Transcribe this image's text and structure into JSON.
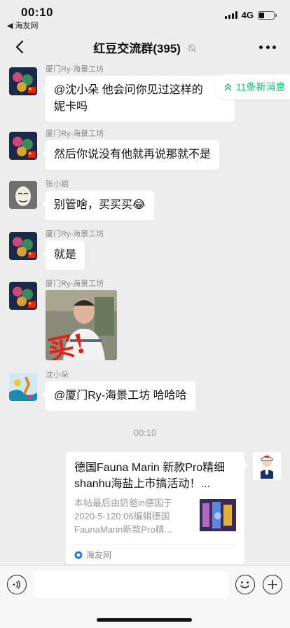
{
  "status": {
    "time": "00:10",
    "back_app": "◀ 海友网",
    "network": "4G"
  },
  "nav": {
    "title": "红豆交流群(395)",
    "icons": [
      "back-chevron-icon",
      "mute-bell-icon",
      "more-dots-icon"
    ]
  },
  "new_messages": {
    "label": "11条新消息",
    "icon": "double-chevron-up-icon",
    "color": "#07c160"
  },
  "messages": [
    {
      "sender": "厦门Ry-海景工坊",
      "lines": [
        "@沈小朵 他会问你见过这样的",
        "妮卡吗"
      ]
    },
    {
      "sender": "厦门Ry-海景工坊",
      "lines": [
        "然后你说没有他就再说那就不是"
      ]
    },
    {
      "sender": "张小姐",
      "text": "别管啥，买买买",
      "emoji": "😂"
    },
    {
      "sender": "厦门Ry-海景工坊",
      "text": "就是"
    },
    {
      "sender": "厦门Ry-海景工坊",
      "image_caption": "买!"
    },
    {
      "sender": "沈小朵",
      "text": "@厦门Ry-海景工坊 哈哈哈"
    }
  ],
  "time_divider": "00:10",
  "link_card": {
    "title": "德国Fauna Marin 新款Pro精细shanhu海盐上市搞活动！...",
    "description": "本帖最后由奶爸in德国于2020-5-120:06编辑德国FaunaMarin新款Pro精...",
    "source": "海友网"
  },
  "input_bar": {
    "placeholder": "",
    "icons": [
      "voice-icon",
      "emoji-icon",
      "plus-icon"
    ]
  },
  "colors": {
    "background": "#ededed",
    "bubble": "#ffffff",
    "accent": "#07c160"
  }
}
